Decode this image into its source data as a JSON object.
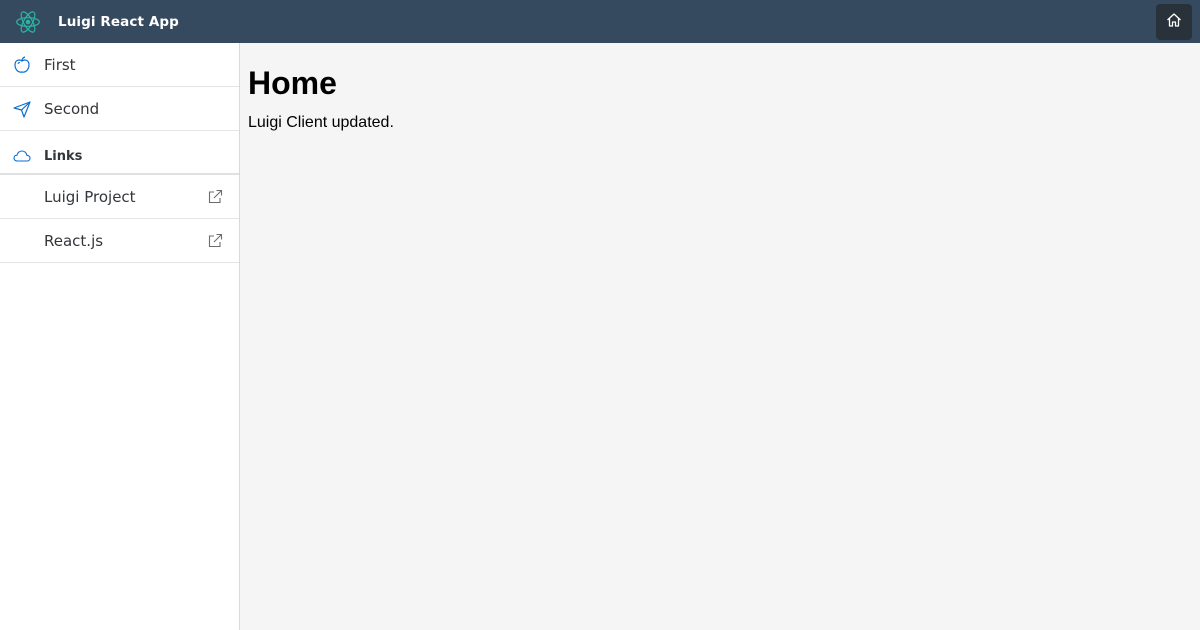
{
  "header": {
    "app_title": "Luigi React App",
    "logo_icon": "react-logo-icon",
    "home_icon": "home-icon",
    "logo_color": "#61dafb",
    "background_color": "#354a5f"
  },
  "sidebar": {
    "items": [
      {
        "label": "First",
        "icon": "apple-icon"
      },
      {
        "label": "Second",
        "icon": "paper-plane-icon"
      }
    ],
    "group": {
      "label": "Links",
      "icon": "cloud-icon",
      "items": [
        {
          "label": "Luigi Project",
          "icon": "external-link-icon"
        },
        {
          "label": "React.js",
          "icon": "external-link-icon"
        }
      ]
    }
  },
  "main": {
    "title": "Home",
    "body_text": "Luigi Client updated."
  }
}
